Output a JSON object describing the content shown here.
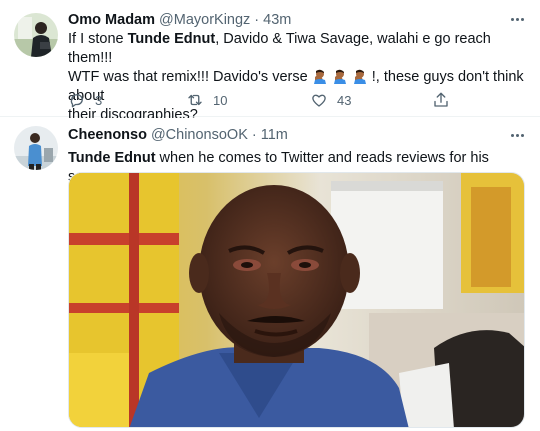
{
  "tweets": [
    {
      "display_name": "Omo Madam",
      "handle": "@MayorKingz",
      "separator": "·",
      "time": "43m",
      "text_line1_a": "If I stone ",
      "text_line1_b": "Tunde Ednut",
      "text_line1_c": ", Davido & Tiwa Savage, walahi e go reach them!!!",
      "text_line2_a": "WTF was that remix!!! Davido's verse",
      "text_line2_b": "!, these guys don't think about",
      "text_line3": "their discographies?",
      "reply_count": "3",
      "retweet_count": "10",
      "like_count": "43",
      "emoji_icon": "man-facepalming-emoji"
    },
    {
      "display_name": "Cheenonso",
      "handle": "@ChinonsoOK",
      "separator": "·",
      "time": "11m",
      "text_a": "Tunde Ednut",
      "text_b": " when he comes to Twitter and reads reviews for his song.",
      "media_icon": "photo-of-man-crying"
    }
  ],
  "colors": {
    "text": "#0f1419",
    "secondary": "#536471",
    "divider": "#eff3f4"
  }
}
